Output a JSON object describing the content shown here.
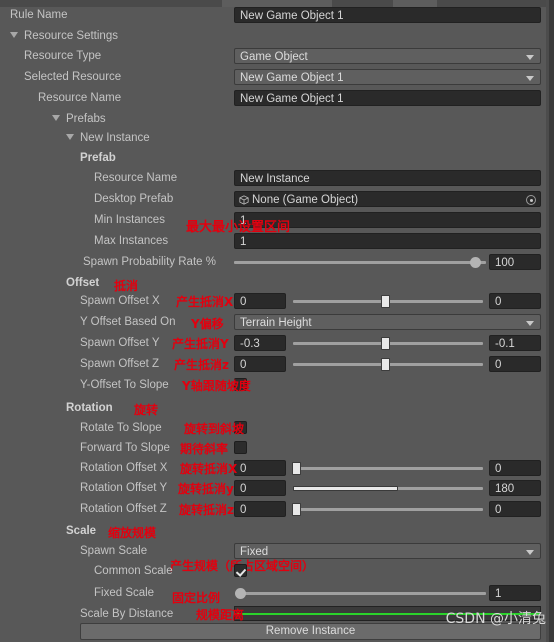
{
  "panel": {
    "watermark": "CSDN @小清兔"
  },
  "rows": {
    "rule_name": {
      "label": "Rule Name",
      "value": "New Game Object 1"
    },
    "resource_settings": {
      "label": "Resource Settings"
    },
    "resource_type": {
      "label": "Resource Type",
      "value": "Game Object"
    },
    "selected_resource": {
      "label": "Selected Resource",
      "value": "New Game Object 1"
    },
    "resource_name": {
      "label": "Resource Name",
      "value": "New Game Object 1"
    },
    "prefabs": {
      "label": "Prefabs"
    },
    "new_instance": {
      "label": "New Instance"
    },
    "prefab_header": {
      "label": "Prefab"
    },
    "prefab_resource_name": {
      "label": "Resource Name",
      "value": "New Instance"
    },
    "desktop_prefab": {
      "label": "Desktop Prefab",
      "value": "None (Game Object)"
    },
    "min_instances": {
      "label": "Min Instances",
      "value": "1"
    },
    "max_instances": {
      "label": "Max Instances",
      "value": "1"
    },
    "spawn_probability": {
      "label": "Spawn Probability Rate %",
      "value": "100"
    },
    "offset_header": {
      "label": "Offset"
    },
    "spawn_offset_x": {
      "label": "Spawn Offset X",
      "min_value": "0",
      "max_value": "0"
    },
    "y_offset_based_on": {
      "label": "Y Offset Based On",
      "value": "Terrain Height"
    },
    "spawn_offset_y": {
      "label": "Spawn Offset Y",
      "min_value": "-0.3",
      "max_value": "-0.1"
    },
    "spawn_offset_z": {
      "label": "Spawn Offset Z",
      "min_value": "0",
      "max_value": "0"
    },
    "y_offset_to_slope": {
      "label": "Y-Offset To Slope",
      "checked": false
    },
    "rotation_header": {
      "label": "Rotation"
    },
    "rotate_to_slope": {
      "label": "Rotate To Slope",
      "checked": false
    },
    "forward_to_slope": {
      "label": "Forward To Slope",
      "checked": false
    },
    "rotation_offset_x": {
      "label": "Rotation Offset X",
      "min_value": "0",
      "max_value": "0"
    },
    "rotation_offset_y": {
      "label": "Rotation Offset Y",
      "min_value": "0",
      "max_value": "180"
    },
    "rotation_offset_z": {
      "label": "Rotation Offset Z",
      "min_value": "0",
      "max_value": "0"
    },
    "scale_header": {
      "label": "Scale"
    },
    "spawn_scale": {
      "label": "Spawn Scale",
      "value": "Fixed"
    },
    "common_scale": {
      "label": "Common Scale",
      "checked": true
    },
    "fixed_scale": {
      "label": "Fixed Scale",
      "value": "1"
    },
    "scale_by_distance": {
      "label": "Scale By Distance"
    },
    "remove_instance": {
      "label": "Remove Instance"
    }
  },
  "annotations": {
    "minmax": "最大最小设置区间",
    "offset": "抵消",
    "spawn_offset_x": "产生抵消X",
    "y_offset": "Y偏移",
    "spawn_offset_y": "产生抵消Y",
    "spawn_offset_z": "产生抵消z",
    "y_offset_slope": "Y轴跟随坡度",
    "rotation": "旋转",
    "rotate_to_slope": "旋转到斜坡",
    "forward_to_slope": "期待斜率",
    "rot_off_x": "旋转抵消X",
    "rot_off_y": "旋转抵消y",
    "rot_off_z": "旋转抵消z",
    "scale": "缩放规模",
    "spawn_scale": "产生规模（所占区域空间）",
    "fixed_scale": "固定比例",
    "scale_by_distance": "规模距离"
  },
  "colors": {
    "background": "#585858",
    "field": "#2a2a2a",
    "popup": "#5f5f5f",
    "annotation": "#e2000f",
    "curve": "#2bd22b"
  }
}
